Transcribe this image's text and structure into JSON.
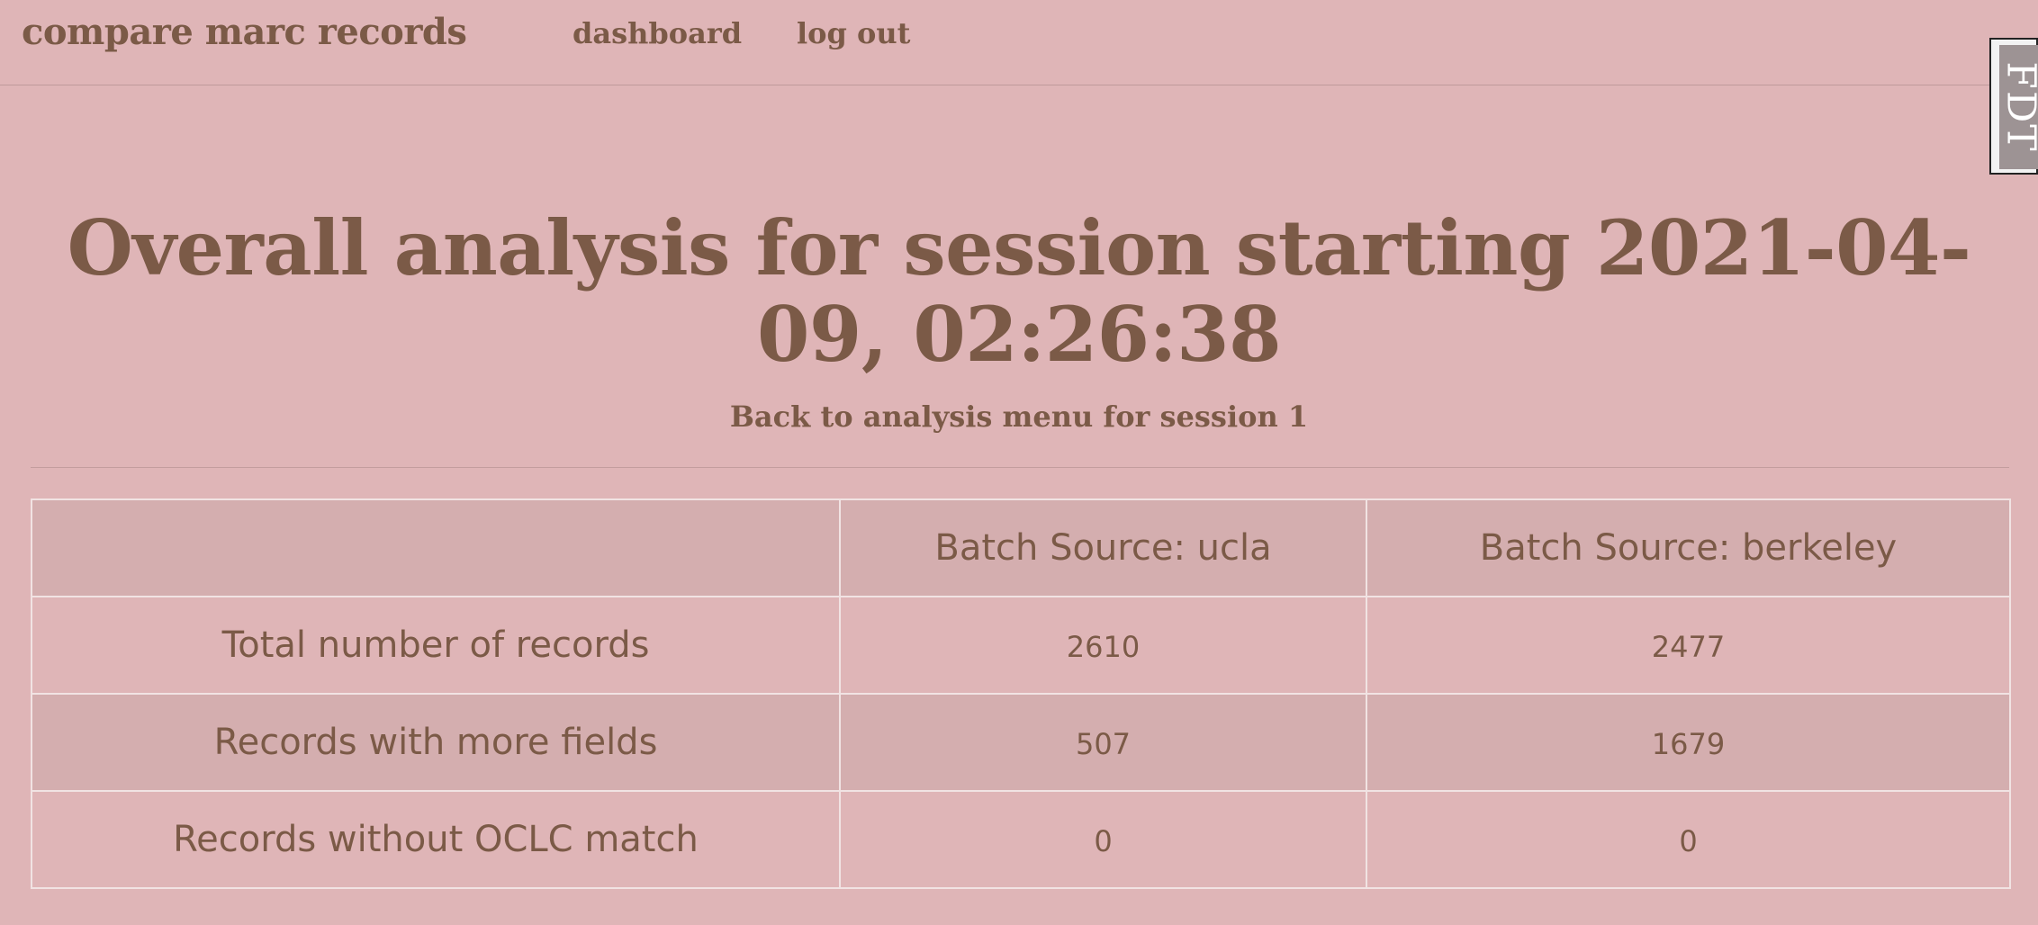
{
  "nav": {
    "brand": "compare marc records",
    "links": [
      "dashboard",
      "log out"
    ]
  },
  "debug_toolbar": {
    "label": "FDT"
  },
  "page": {
    "title": "Overall analysis for session starting 2021-04-09, 02:26:38",
    "back_link": "Back to analysis menu for session 1"
  },
  "table": {
    "columns": [
      "",
      "Batch Source: ucla",
      "Batch Source: berkeley"
    ],
    "rows": [
      {
        "label": "Total number of records",
        "values": [
          "2610",
          "2477"
        ]
      },
      {
        "label": "Records with more fields",
        "values": [
          "507",
          "1679"
        ]
      },
      {
        "label": "Records without OCLC match",
        "values": [
          "0",
          "0"
        ]
      }
    ]
  },
  "colors": {
    "background": "#dfb5b7",
    "text": "#7b5a47",
    "shaded_row": "#d4aeaf",
    "table_border": "#f1e3e3"
  }
}
